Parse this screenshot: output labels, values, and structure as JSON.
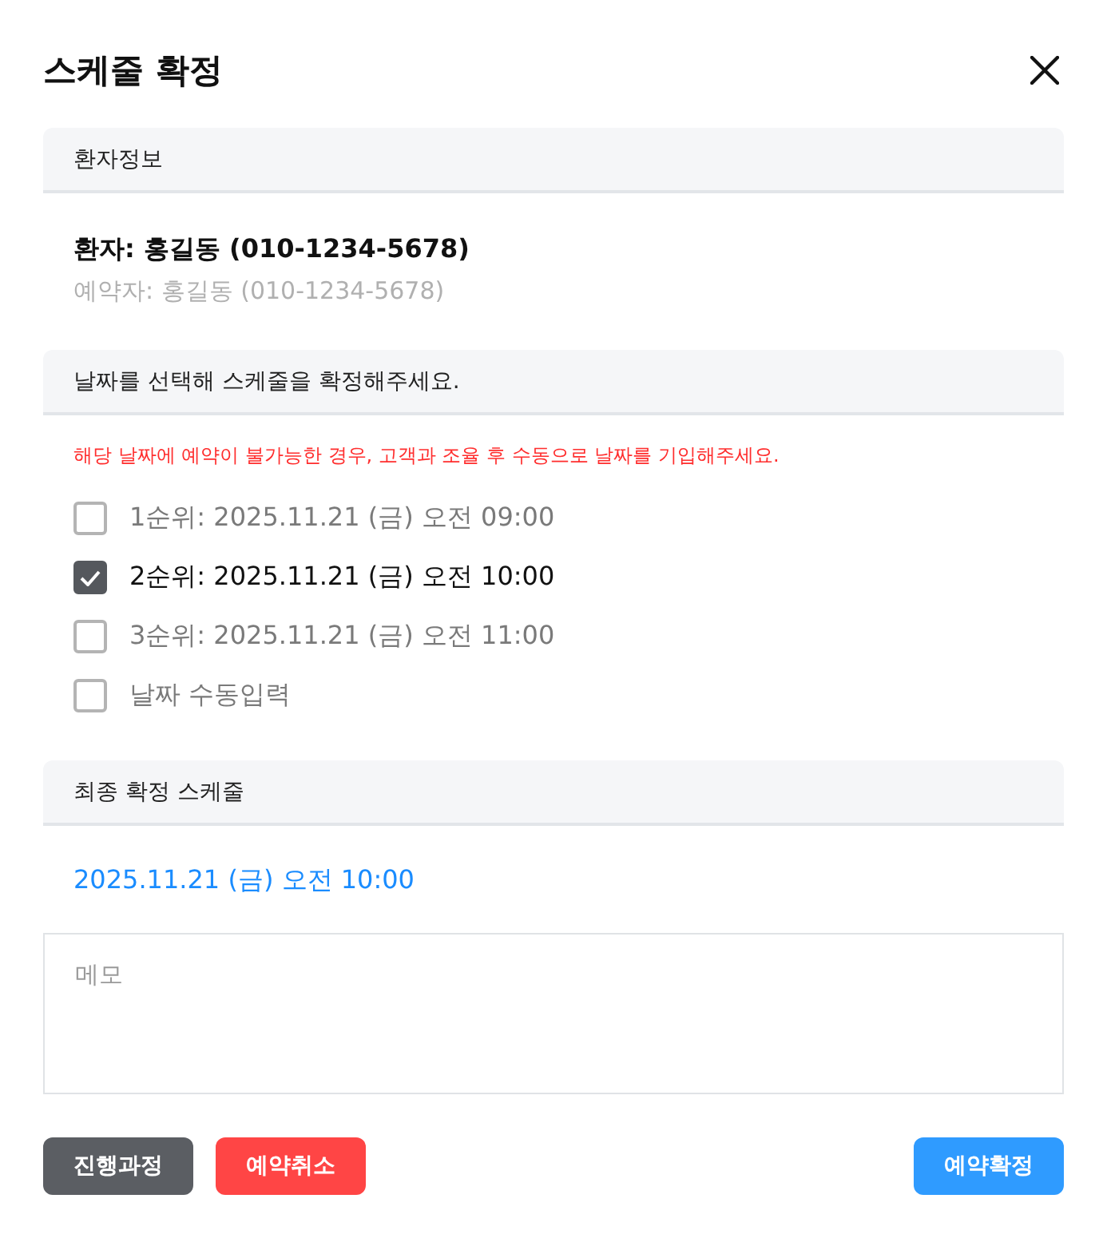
{
  "dialog": {
    "title": "스케줄 확정"
  },
  "patient_section": {
    "heading": "환자정보",
    "patient": "환자: 홍길동 (010-1234-5678)",
    "booker": "예약자: 홍길동 (010-1234-5678)"
  },
  "date_section": {
    "heading": "날짜를 선택해 스케줄을 확정해주세요.",
    "warning": "해당 날짜에 예약이 불가능한 경우, 고객과 조율 후 수동으로 날짜를 기입해주세요.",
    "options": [
      {
        "label": "1순위: 2025.11.21 (금) 오전 09:00",
        "checked": false
      },
      {
        "label": "2순위: 2025.11.21 (금) 오전 10:00",
        "checked": true
      },
      {
        "label": "3순위: 2025.11.21 (금) 오전 11:00",
        "checked": false
      },
      {
        "label": "날짜 수동입력",
        "checked": false
      }
    ]
  },
  "final_section": {
    "heading": "최종 확정 스케줄",
    "value": "2025.11.21 (금) 오전 10:00"
  },
  "memo": {
    "placeholder": "메모"
  },
  "buttons": [
    {
      "label": "진행과정",
      "kind": "secondary"
    },
    {
      "label": "예약취소",
      "kind": "danger"
    },
    {
      "label": "예약확정",
      "kind": "primary"
    }
  ]
}
